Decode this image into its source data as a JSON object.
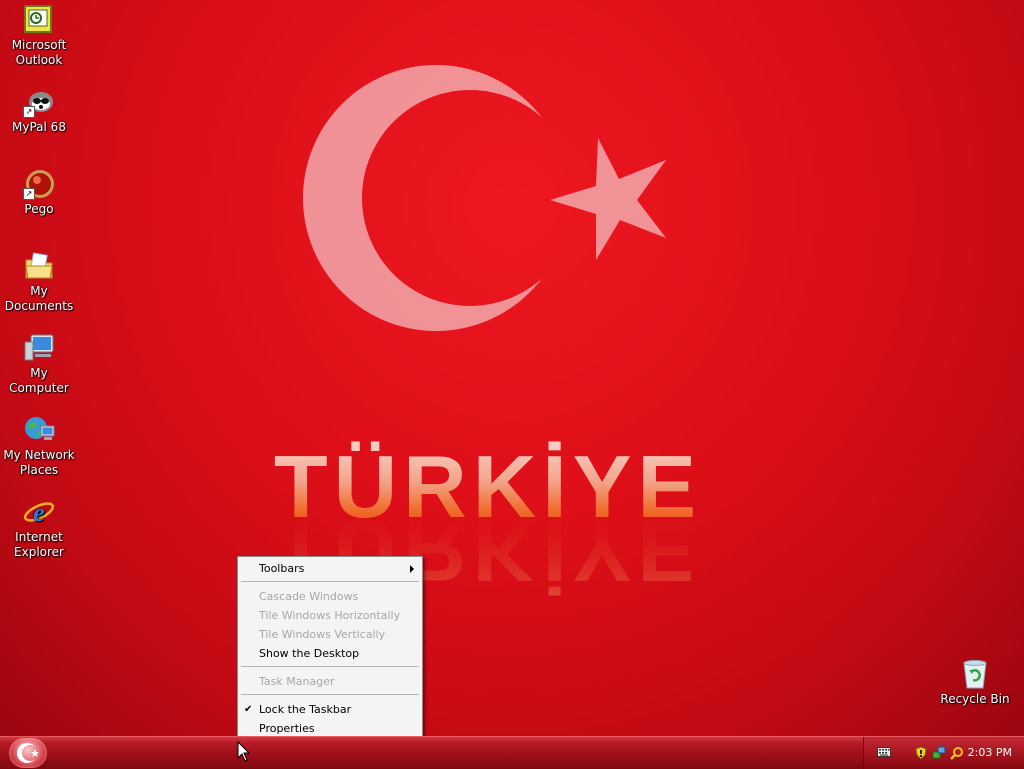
{
  "desktop": {
    "wallpaper_text": "TÜRKİYE",
    "icons": [
      {
        "label_1": "Microsoft",
        "label_2": "Outlook",
        "icon": "outlook-icon"
      },
      {
        "label_1": "MyPal 68",
        "label_2": "",
        "icon": "mypal-icon"
      },
      {
        "label_1": "Pego",
        "label_2": "",
        "icon": "pego-icon"
      },
      {
        "label_1": "My",
        "label_2": "Documents",
        "icon": "my-documents-icon"
      },
      {
        "label_1": "My Computer",
        "label_2": "",
        "icon": "my-computer-icon"
      },
      {
        "label_1": "My Network",
        "label_2": "Places",
        "icon": "network-places-icon"
      },
      {
        "label_1": "Internet",
        "label_2": "Explorer",
        "icon": "internet-explorer-icon"
      },
      {
        "label_1": "Recycle Bin",
        "label_2": "",
        "icon": "recycle-bin-icon"
      }
    ]
  },
  "context_menu": {
    "items": [
      {
        "label": "Toolbars",
        "enabled": true,
        "submenu": true
      },
      {
        "label": "Cascade Windows",
        "enabled": false
      },
      {
        "label": "Tile Windows Horizontally",
        "enabled": false
      },
      {
        "label": "Tile Windows Vertically",
        "enabled": false
      },
      {
        "label": "Show the Desktop",
        "enabled": true
      },
      {
        "label": "Task Manager",
        "enabled": false
      },
      {
        "label": "Lock the Taskbar",
        "enabled": true,
        "checked": true,
        "check_glyph": "✔"
      },
      {
        "label": "Properties",
        "enabled": true
      }
    ]
  },
  "taskbar": {
    "clock": "2:03 PM",
    "tray_icons": [
      "keyboard-icon",
      "security-shield-icon",
      "network-icon",
      "search-icon"
    ]
  },
  "colors": {
    "wallpaper_red": "#dc0e18",
    "taskbar_red": "#9c0f18",
    "menu_bg": "#f4f4f4",
    "disabled_text": "#a6a6a6"
  }
}
